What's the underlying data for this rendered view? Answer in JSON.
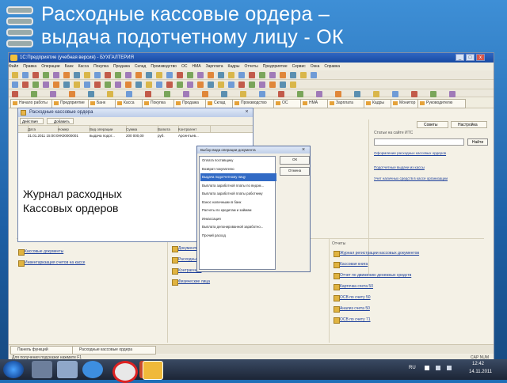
{
  "slide": {
    "title_line1": "Расходные кассовые ордера –",
    "title_line2": "выдача подотчетному лицу - ОК"
  },
  "app": {
    "window_title": "1С:Предприятие (учебная версия) - БУХГАЛТЕРИЯ",
    "menu": [
      "Файл",
      "Правка",
      "Операции",
      "Банк",
      "Касса",
      "Покупка",
      "Продажа",
      "Склад",
      "Производство",
      "ОС",
      "НМА",
      "Зарплата",
      "Кадры",
      "Отчеты",
      "Предприятие",
      "Сервис",
      "Окна",
      "Справка"
    ],
    "panel_tabs": [
      "Начало работы",
      "Предприятие",
      "Банк",
      "Касса",
      "Покупка",
      "Продажа",
      "Склад",
      "Производство",
      "ОС",
      "НМА",
      "Зарплата",
      "Кадры",
      "Монитор",
      "Руководителю"
    ],
    "right_buttons": [
      "Советы",
      "Настройка"
    ],
    "right_section_title": "Статьи на сайте ИТС",
    "right_search_button": "Найти",
    "reports_title": "Отчеты",
    "left_links": [
      "Кассовые документы",
      "Инвентаризация счетов на кассе",
      "Документы",
      "Расходные ордера",
      "Контрагенты",
      "Физические лица"
    ],
    "right_links": [
      "Журнал регистрации кассовых документов",
      "Кассовая книга",
      "Отчет по движению денежных средств",
      "Карточка счета 50",
      "ОСВ по счету 50",
      "Анализ счета 50",
      "ОСВ по счету 71"
    ],
    "bottom_tabs": [
      "Панель функций",
      "Расходные кассовые ордера"
    ],
    "status_text": "Для получения подсказки нажмите F1",
    "caps_num": "CAP NUM"
  },
  "journal": {
    "title": "Расходные кассовые ордера",
    "actions_label": "Действия",
    "add_label": "Добавить",
    "columns": [
      "",
      "Дата",
      "Номер",
      "Вид операции",
      "Сумма",
      "Валюта",
      "Контрагент"
    ],
    "row": [
      "",
      "31.01.2011 15:00:00",
      "НК00000001",
      "выдача подот...",
      "200 000,00",
      "руб.",
      "Арсентьев..."
    ],
    "caption_line1": "Журнал расходных",
    "caption_line2": "Кассовых ордеров"
  },
  "dialog": {
    "title": "Выбор вида операции документа",
    "close": "×",
    "options": [
      "Оплата поставщику",
      "Возврат покупателю",
      "Выдача подотчетному лицу",
      "Выплата заработной платы по ведом...",
      "Выплата заработной платы работнику",
      "Взнос наличными в банк",
      "Расчеты по кредитам и займам",
      "Инкассация",
      "Выплата депонированной заработно...",
      "Прочий расход"
    ],
    "selected_index": 2,
    "ok_label": "ОК",
    "cancel_label": "Отмена"
  },
  "taskbar": {
    "lang": "RU",
    "time": "12:42",
    "date": "14.11.2011"
  }
}
